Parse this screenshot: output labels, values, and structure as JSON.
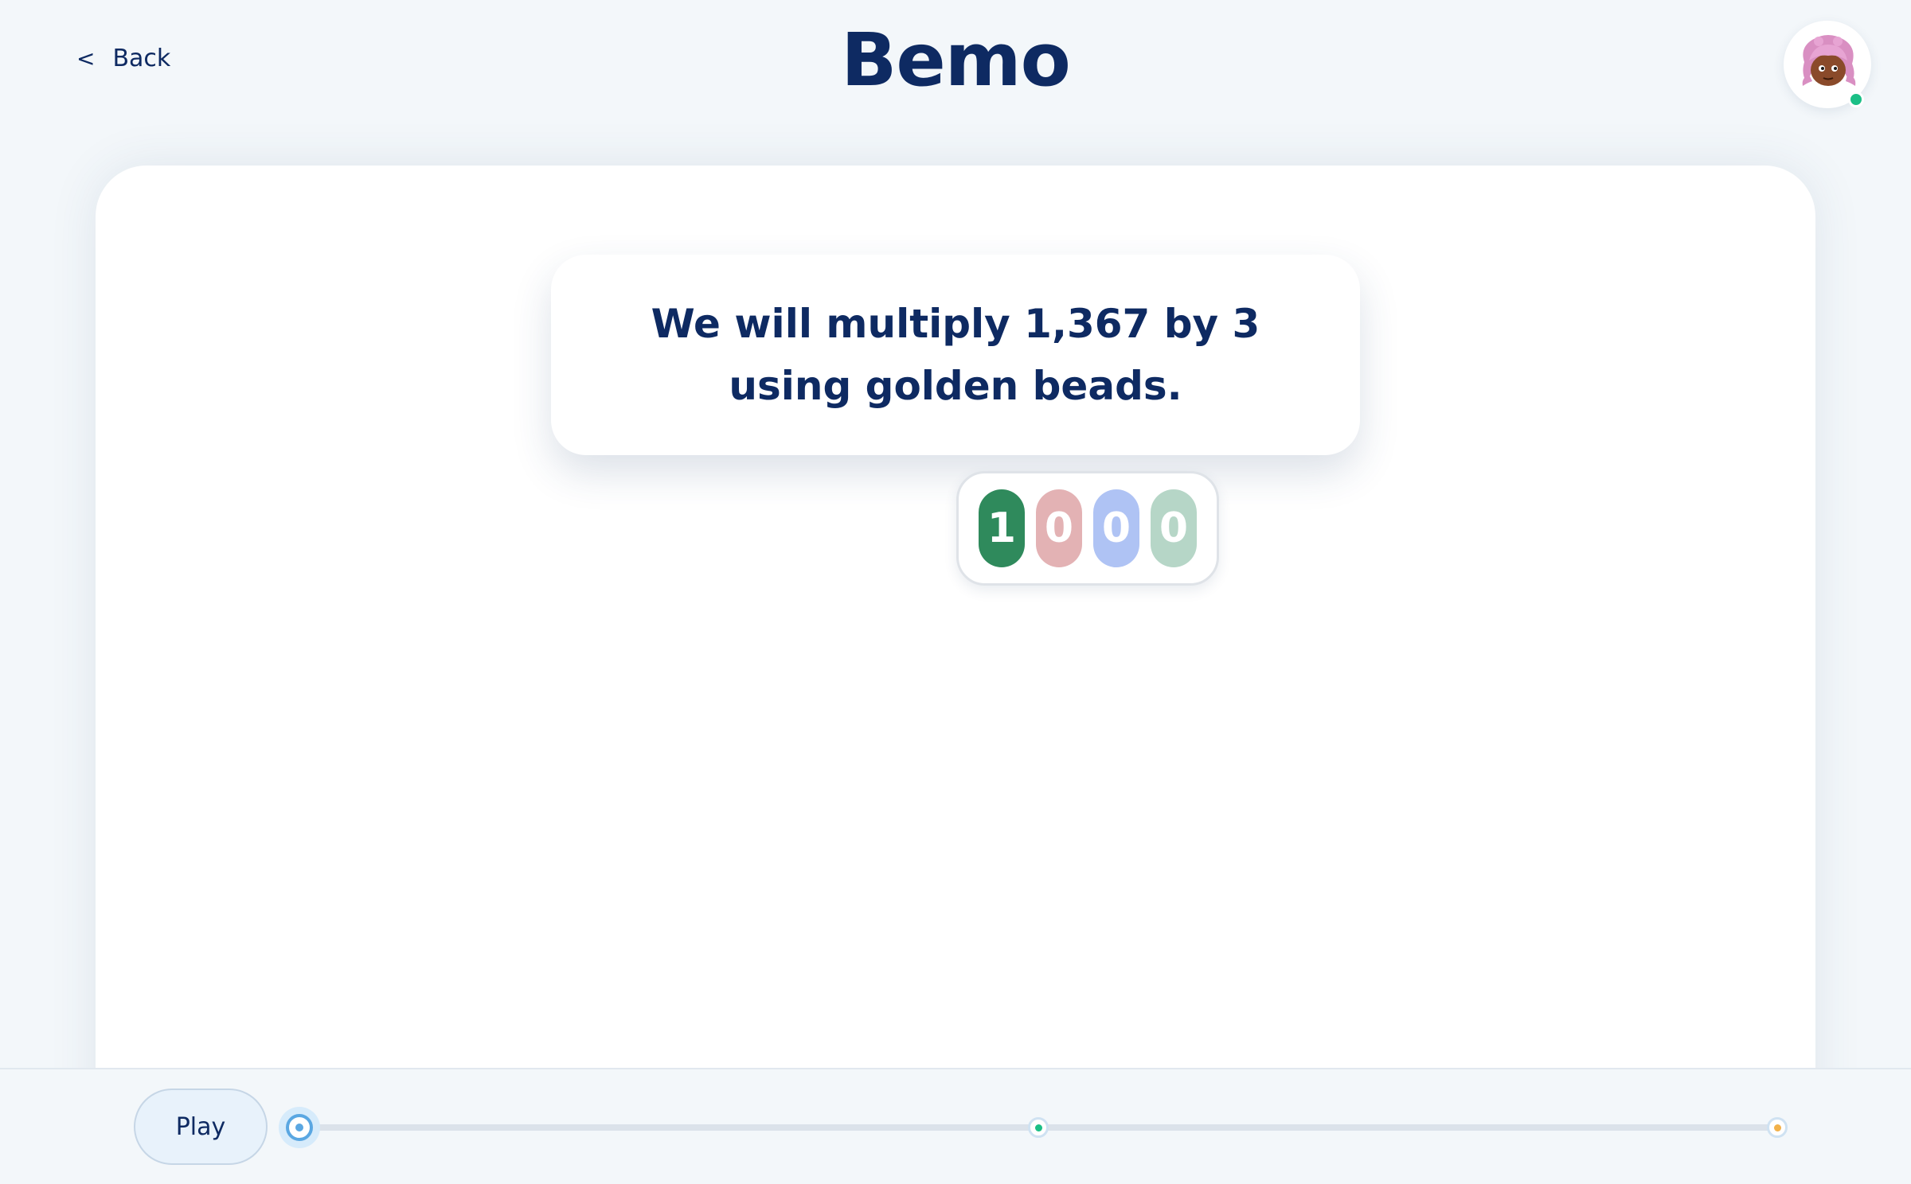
{
  "header": {
    "back_label": "Back",
    "back_icon": "chevron-left-icon",
    "back_glyph": "<",
    "title": "Bemo",
    "avatar": {
      "icon": "character-avatar-icon",
      "status": "online",
      "status_color": "#1bbf86"
    }
  },
  "lesson": {
    "prompt": "We will multiply 1,367 by 3 using golden beads.",
    "number_card": {
      "digits": [
        {
          "value": "1",
          "color": "#2f8a5c"
        },
        {
          "value": "0",
          "color": "#e3b2b4"
        },
        {
          "value": "0",
          "color": "#afc3f4"
        },
        {
          "value": "0",
          "color": "#b6d6c7"
        }
      ]
    }
  },
  "player": {
    "play_label": "Play",
    "progress": 0,
    "markers": [
      {
        "name": "marker-middle",
        "position": 0.5,
        "color": "#1bbf86"
      },
      {
        "name": "marker-end",
        "position": 1.0,
        "color": "#f2b14a"
      }
    ]
  },
  "colors": {
    "text_primary": "#0e2a62",
    "background": "#f3f7fa",
    "accent": "#5aa7e2"
  }
}
